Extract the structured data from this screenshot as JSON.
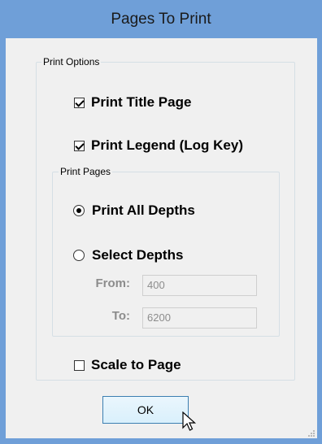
{
  "window": {
    "title": "Pages To Print"
  },
  "print_options": {
    "legend": "Print Options",
    "print_title_page": {
      "label": "Print Title Page",
      "checked": true
    },
    "print_legend": {
      "label": "Print Legend (Log Key)",
      "checked": true
    },
    "scale_to_page": {
      "label": "Scale to Page",
      "checked": false
    }
  },
  "print_pages": {
    "legend": "Print Pages",
    "all_depths": {
      "label": "Print All Depths",
      "selected": true
    },
    "select_depths": {
      "label": "Select Depths",
      "selected": false
    },
    "from": {
      "label": "From:",
      "value": "400"
    },
    "to": {
      "label": "To:",
      "value": "6200"
    }
  },
  "buttons": {
    "ok": "OK"
  }
}
